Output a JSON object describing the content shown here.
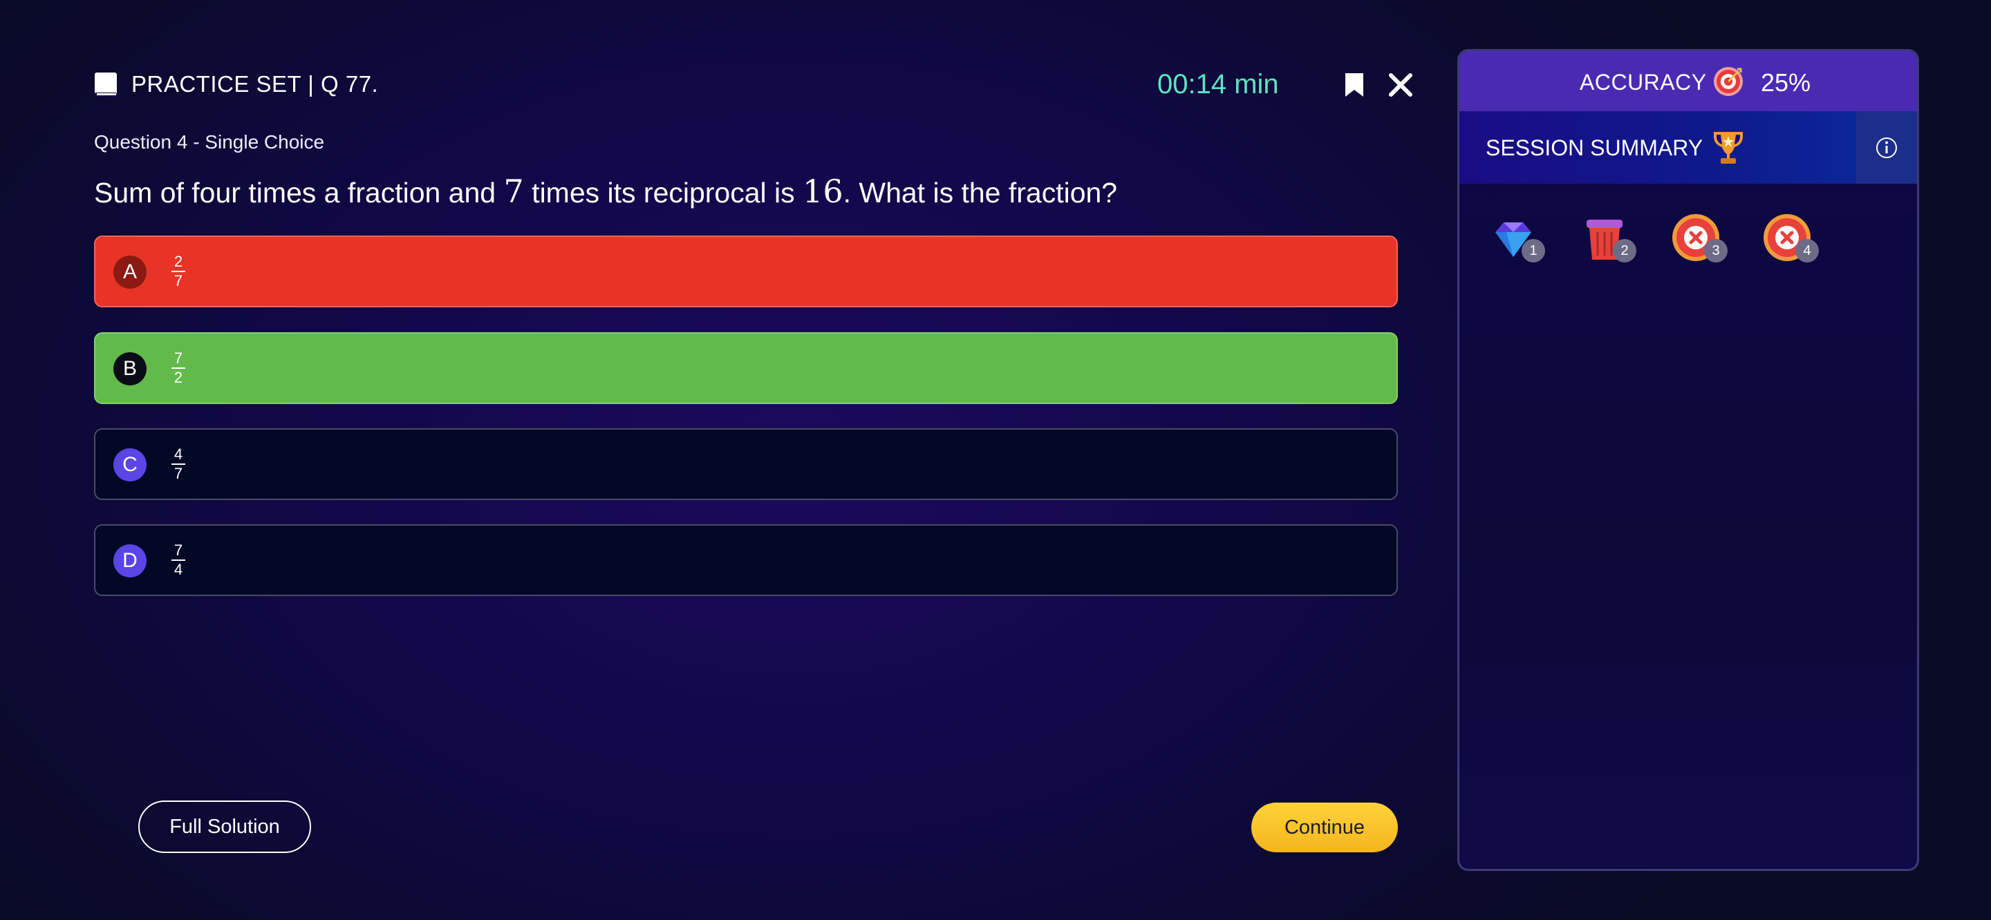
{
  "header": {
    "book_icon": "book-icon",
    "title": "PRACTICE SET | Q 77.",
    "timer": "00:14 min",
    "bookmark_icon": "bookmark-icon",
    "close_icon": "close-icon"
  },
  "question": {
    "meta": "Question 4 - Single Choice",
    "text_before": "Sum of four times a fraction and ",
    "num1": "7",
    "text_mid": " times its reciprocal is ",
    "num2": "16",
    "text_after": ". What is the fraction?"
  },
  "options": [
    {
      "letter": "A",
      "num": "2",
      "den": "7",
      "state": "incorrect",
      "color": "#e83426"
    },
    {
      "letter": "B",
      "num": "7",
      "den": "2",
      "state": "correct",
      "color": "#62ba4a"
    },
    {
      "letter": "C",
      "num": "4",
      "den": "7",
      "state": "default",
      "color": "#030827"
    },
    {
      "letter": "D",
      "num": "7",
      "den": "4",
      "state": "default",
      "color": "#030827"
    }
  ],
  "buttons": {
    "full_solution": "Full Solution",
    "continue": "Continue"
  },
  "panel": {
    "accuracy_label": "ACCURACY",
    "accuracy_icon": "target-icon",
    "accuracy_value": "25%",
    "summary_label": "SESSION SUMMARY",
    "trophy_icon": "trophy-icon",
    "info_icon": "info-icon",
    "badges": [
      {
        "icon": "diamond-icon",
        "count": "1"
      },
      {
        "icon": "trash-icon",
        "count": "2"
      },
      {
        "icon": "wrong-icon",
        "count": "3"
      },
      {
        "icon": "wrong-icon",
        "count": "4"
      }
    ]
  },
  "colors": {
    "accent": "#4a2ab3",
    "timer": "#5fe3c0",
    "correct": "#62ba4a",
    "incorrect": "#e83426",
    "continue": "#f4b51c"
  }
}
